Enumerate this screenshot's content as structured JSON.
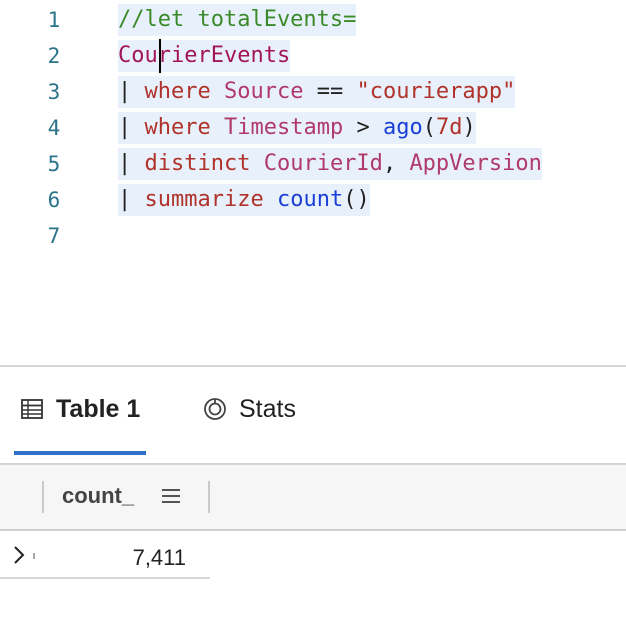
{
  "editor": {
    "lines": [
      {
        "num": "1",
        "tokens": [
          "//let totalEvents="
        ]
      },
      {
        "num": "2",
        "tokens": [
          "CourierEvents"
        ]
      },
      {
        "num": "3",
        "tokens": [
          "| ",
          "where",
          " ",
          "Source",
          " == ",
          "\"courierapp\""
        ]
      },
      {
        "num": "4",
        "tokens": [
          "| ",
          "where",
          " ",
          "Timestamp",
          " > ",
          "ago",
          "(",
          "7d",
          ")"
        ]
      },
      {
        "num": "5",
        "tokens": [
          "| ",
          "distinct",
          " ",
          "CourierId",
          ", ",
          "AppVersion"
        ]
      },
      {
        "num": "6",
        "tokens": [
          "| ",
          "summarize",
          " ",
          "count",
          "()"
        ]
      },
      {
        "num": "7",
        "tokens": []
      }
    ]
  },
  "tabs": {
    "table_label": "Table 1",
    "stats_label": "Stats",
    "table_icon": "table-grid-icon",
    "stats_icon": "stats-gauge-icon"
  },
  "grid": {
    "column_header": "count_",
    "column_menu_icon": "column-menu-icon",
    "expand_icon": "chevron-right-icon",
    "rows": [
      {
        "count_": "7,411"
      }
    ]
  },
  "colors": {
    "comment": "#3a8a2a",
    "keyword": "#b0322a",
    "function": "#1a3fd6",
    "table_name": "#a3155b",
    "line_highlight": "#e8f1fb",
    "active_tab_underline": "#2f6fca"
  }
}
